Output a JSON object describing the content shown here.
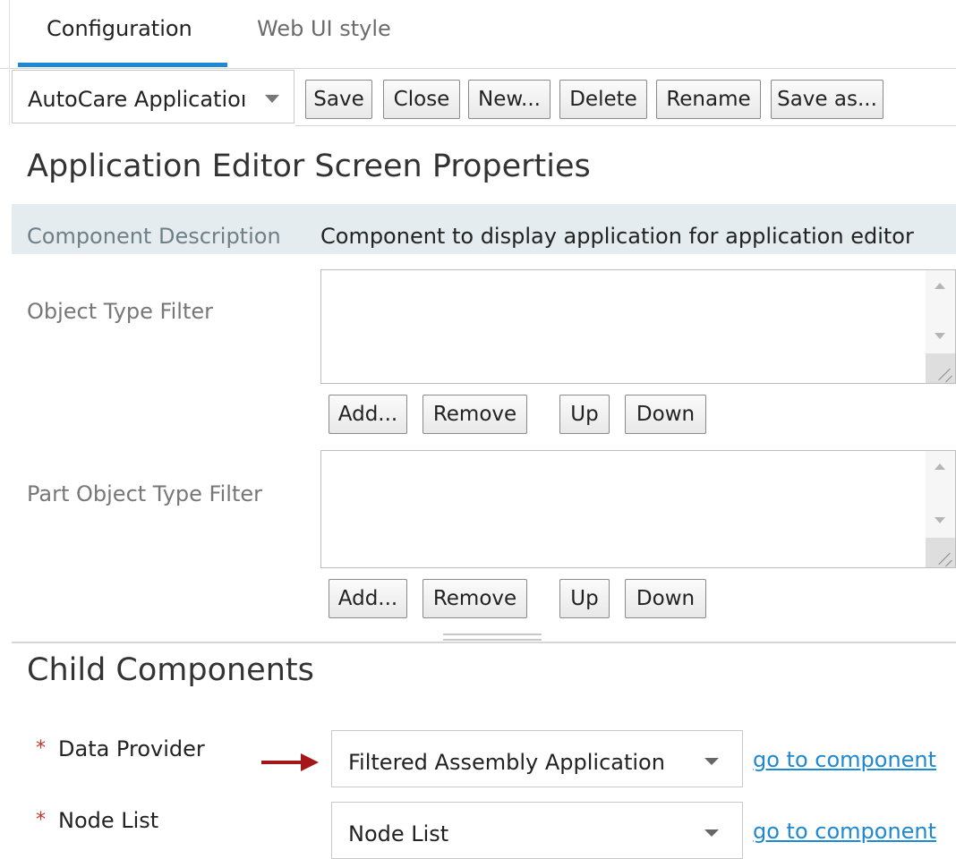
{
  "tabs": [
    {
      "label": "Configuration",
      "active": true
    },
    {
      "label": "Web UI style",
      "active": false
    }
  ],
  "toolbar": {
    "config_select_value": "AutoCare Applicatioı",
    "save_label": "Save",
    "close_label": "Close",
    "new_label": "New...",
    "delete_label": "Delete",
    "rename_label": "Rename",
    "save_as_label": "Save as..."
  },
  "properties": {
    "title": "Application Editor Screen Properties",
    "component_description_label": "Component Description",
    "component_description_value": "Component to display application  for application editor",
    "object_type_filter": {
      "label": "Object Type Filter",
      "add_label": "Add...",
      "remove_label": "Remove",
      "up_label": "Up",
      "down_label": "Down"
    },
    "part_object_type_filter": {
      "label": "Part Object Type Filter",
      "add_label": "Add...",
      "remove_label": "Remove",
      "up_label": "Up",
      "down_label": "Down"
    }
  },
  "child_components": {
    "title": "Child Components",
    "required_marker": "*",
    "data_provider": {
      "label": "Data Provider",
      "value": "Filtered Assembly Application",
      "link": "go to component"
    },
    "node_list": {
      "label": "Node List",
      "value": "Node List",
      "link": "go to component"
    }
  },
  "colors": {
    "accent": "#1e88d2",
    "required": "#c0392b",
    "arrow": "#a4161a",
    "description_row_bg": "#e4ecef"
  },
  "icons": [
    "chevron-down-icon",
    "scroll-up-icon",
    "scroll-down-icon",
    "resize-grip-icon",
    "annotation-arrow-icon"
  ]
}
